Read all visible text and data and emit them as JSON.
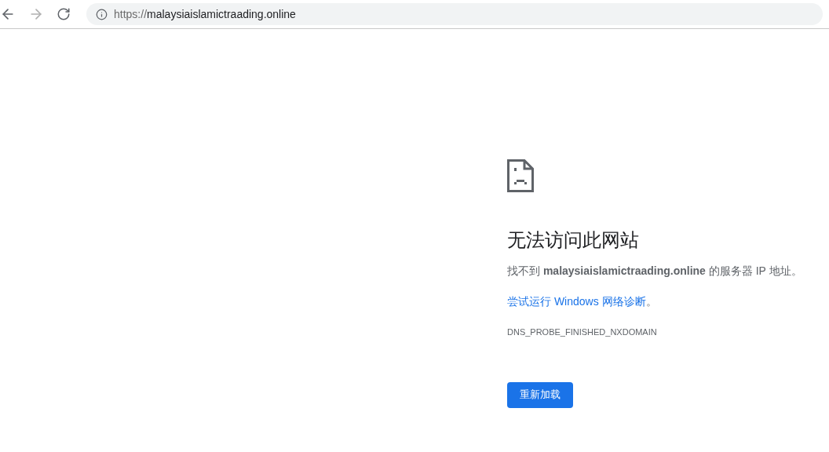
{
  "toolbar": {
    "back": {
      "disabled": false
    },
    "forward": {
      "disabled": true
    },
    "address": {
      "scheme": "https://",
      "host": "malaysiaislamictraading.online"
    }
  },
  "error": {
    "title": "无法访问此网站",
    "message": "找不到 **malaysiaislamictraading.online** 的服务器 IP 地址。",
    "suggestion_link": "尝试运行 Windows 网络诊断",
    "suggestion_end": "。",
    "code": "DNS_PROBE_FINISHED_NXDOMAIN",
    "button": "重新加载"
  }
}
